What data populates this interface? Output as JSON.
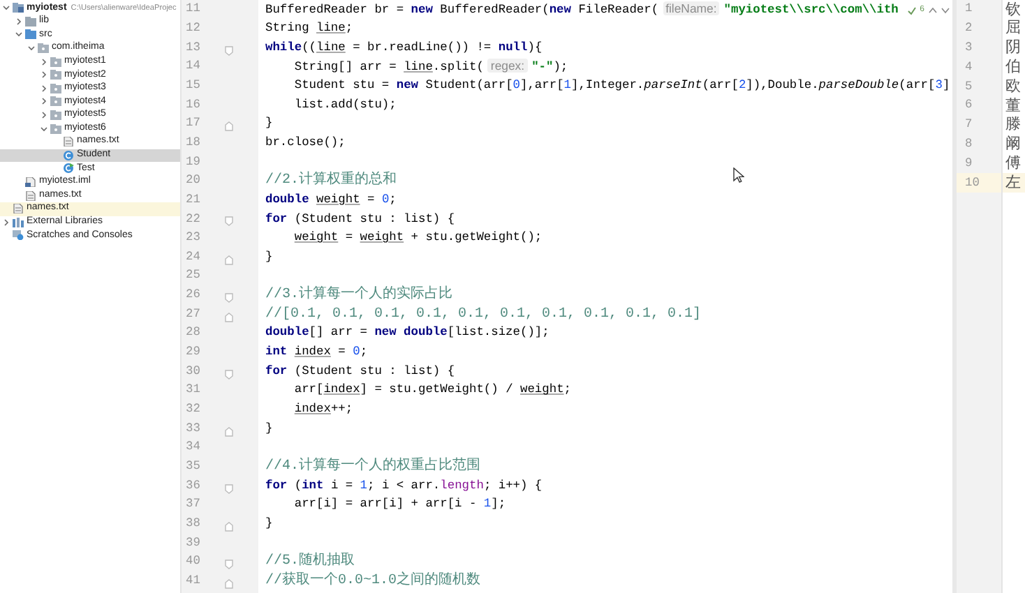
{
  "project_tree": {
    "items": [
      {
        "label": "myiotest",
        "kind": "module",
        "path": "C:\\Users\\alienware\\IdeaProjec",
        "expanded": true,
        "selected": false,
        "highlighted": false,
        "children": [
          {
            "label": "lib",
            "kind": "folder",
            "expanded": false,
            "selected": false,
            "highlighted": false
          },
          {
            "label": "src",
            "kind": "source-folder",
            "expanded": true,
            "selected": false,
            "highlighted": false,
            "children": [
              {
                "label": "com.itheima",
                "kind": "package",
                "expanded": true,
                "selected": false,
                "highlighted": false,
                "children": [
                  {
                    "label": "myiotest1",
                    "kind": "package",
                    "expanded": false,
                    "selected": false,
                    "highlighted": false
                  },
                  {
                    "label": "myiotest2",
                    "kind": "package",
                    "expanded": false,
                    "selected": false,
                    "highlighted": false
                  },
                  {
                    "label": "myiotest3",
                    "kind": "package",
                    "expanded": false,
                    "selected": false,
                    "highlighted": false
                  },
                  {
                    "label": "myiotest4",
                    "kind": "package",
                    "expanded": false,
                    "selected": false,
                    "highlighted": false
                  },
                  {
                    "label": "myiotest5",
                    "kind": "package",
                    "expanded": false,
                    "selected": false,
                    "highlighted": false
                  },
                  {
                    "label": "myiotest6",
                    "kind": "package",
                    "expanded": true,
                    "selected": false,
                    "highlighted": false,
                    "children": [
                      {
                        "label": "names.txt",
                        "kind": "text-file",
                        "selected": false,
                        "highlighted": false
                      },
                      {
                        "label": "Student",
                        "kind": "class",
                        "selected": true,
                        "highlighted": false
                      },
                      {
                        "label": "Test",
                        "kind": "runnable-class",
                        "selected": false,
                        "highlighted": false
                      }
                    ]
                  }
                ]
              }
            ]
          },
          {
            "label": "myiotest.iml",
            "kind": "module-file",
            "selected": false,
            "highlighted": false
          },
          {
            "label": "names.txt",
            "kind": "text-file",
            "selected": false,
            "highlighted": false
          }
        ]
      },
      {
        "label": "names.txt",
        "kind": "text-file",
        "selected": false,
        "highlighted": true
      },
      {
        "label": "External Libraries",
        "kind": "library",
        "expanded": false,
        "selected": false,
        "highlighted": false
      },
      {
        "label": "Scratches and Consoles",
        "kind": "scratches",
        "selected": false,
        "highlighted": false
      }
    ]
  },
  "editor": {
    "inspection": {
      "count": "6"
    },
    "lines": [
      {
        "number": "11",
        "segments": [
          {
            "kind": "plain",
            "text": "BufferedReader br = "
          },
          {
            "kind": "keyword",
            "text": "new"
          },
          {
            "kind": "plain",
            "text": " BufferedReader("
          },
          {
            "kind": "keyword",
            "text": "new"
          },
          {
            "kind": "plain",
            "text": " FileReader("
          },
          {
            "kind": "hint",
            "text": "fileName:"
          },
          {
            "kind": "string",
            "text": "\"myiotest\\\\src\\\\com\\\\ith"
          }
        ]
      },
      {
        "number": "12",
        "segments": [
          {
            "kind": "plain",
            "text": "String "
          },
          {
            "kind": "reassigned",
            "text": "line"
          },
          {
            "kind": "plain",
            "text": ";"
          }
        ]
      },
      {
        "number": "13",
        "kind": "fold-start",
        "segments": [
          {
            "kind": "keyword",
            "text": "while"
          },
          {
            "kind": "plain",
            "text": "(("
          },
          {
            "kind": "reassigned",
            "text": "line"
          },
          {
            "kind": "plain",
            "text": " = br.readLine()) != "
          },
          {
            "kind": "keyword",
            "text": "null"
          },
          {
            "kind": "plain",
            "text": "){"
          }
        ]
      },
      {
        "number": "14",
        "segments": [
          {
            "kind": "plain",
            "text": "    String[] arr = "
          },
          {
            "kind": "reassigned",
            "text": "line"
          },
          {
            "kind": "plain",
            "text": ".split("
          },
          {
            "kind": "hint",
            "text": "regex:"
          },
          {
            "kind": "string",
            "text": "\"-\""
          },
          {
            "kind": "plain",
            "text": ");"
          }
        ]
      },
      {
        "number": "15",
        "segments": [
          {
            "kind": "plain",
            "text": "    Student stu = "
          },
          {
            "kind": "keyword",
            "text": "new"
          },
          {
            "kind": "plain",
            "text": " Student(arr["
          },
          {
            "kind": "number",
            "text": "0"
          },
          {
            "kind": "plain",
            "text": "],arr["
          },
          {
            "kind": "number",
            "text": "1"
          },
          {
            "kind": "plain",
            "text": "],Integer."
          },
          {
            "kind": "static",
            "text": "parseInt"
          },
          {
            "kind": "plain",
            "text": "(arr["
          },
          {
            "kind": "number",
            "text": "2"
          },
          {
            "kind": "plain",
            "text": "]),Double."
          },
          {
            "kind": "static",
            "text": "parseDouble"
          },
          {
            "kind": "plain",
            "text": "(arr["
          },
          {
            "kind": "number",
            "text": "3"
          },
          {
            "kind": "plain",
            "text": "]"
          }
        ]
      },
      {
        "number": "16",
        "segments": [
          {
            "kind": "plain",
            "text": "    list.add(stu);"
          }
        ]
      },
      {
        "number": "17",
        "kind": "fold-end",
        "segments": [
          {
            "kind": "plain",
            "text": "}"
          }
        ]
      },
      {
        "number": "18",
        "segments": [
          {
            "kind": "plain",
            "text": "br.close();"
          }
        ]
      },
      {
        "number": "19"
      },
      {
        "number": "20",
        "segments": [
          {
            "kind": "comment",
            "text": "//2.计算权重的总和"
          }
        ]
      },
      {
        "number": "21",
        "segments": [
          {
            "kind": "keyword",
            "text": "double "
          },
          {
            "kind": "reassigned",
            "text": "weight"
          },
          {
            "kind": "plain",
            "text": " = "
          },
          {
            "kind": "number",
            "text": "0"
          },
          {
            "kind": "plain",
            "text": ";"
          }
        ]
      },
      {
        "number": "22",
        "kind": "fold-start",
        "segments": [
          {
            "kind": "keyword",
            "text": "for"
          },
          {
            "kind": "plain",
            "text": " (Student stu : list) {"
          }
        ]
      },
      {
        "number": "23",
        "segments": [
          {
            "kind": "reassigned",
            "text": "    weight"
          },
          {
            "kind": "plain",
            "text": " = "
          },
          {
            "kind": "reassigned",
            "text": "weight"
          },
          {
            "kind": "plain",
            "text": " + stu.getWeight();"
          }
        ]
      },
      {
        "number": "24",
        "kind": "fold-end",
        "segments": [
          {
            "kind": "plain",
            "text": "}"
          }
        ]
      },
      {
        "number": "25"
      },
      {
        "number": "26",
        "kind": "fold-start",
        "segments": [
          {
            "kind": "comment",
            "text": "//3.计算每一个人的实际占比"
          }
        ]
      },
      {
        "number": "27",
        "kind": "fold-end",
        "segments": [
          {
            "kind": "comment",
            "text": "//[0.1, 0.1, 0.1, 0.1, 0.1, 0.1, 0.1, 0.1, 0.1, 0.1]"
          }
        ]
      },
      {
        "number": "28",
        "segments": [
          {
            "kind": "keyword",
            "text": "double"
          },
          {
            "kind": "plain",
            "text": "[] arr = "
          },
          {
            "kind": "keyword",
            "text": "new double"
          },
          {
            "kind": "plain",
            "text": "[list.size()];"
          }
        ]
      },
      {
        "number": "29",
        "segments": [
          {
            "kind": "keyword",
            "text": "int "
          },
          {
            "kind": "reassigned",
            "text": "index"
          },
          {
            "kind": "plain",
            "text": " = "
          },
          {
            "kind": "number",
            "text": "0"
          },
          {
            "kind": "plain",
            "text": ";"
          }
        ]
      },
      {
        "number": "30",
        "kind": "fold-start",
        "segments": [
          {
            "kind": "keyword",
            "text": "for"
          },
          {
            "kind": "plain",
            "text": " (Student stu : list) {"
          }
        ]
      },
      {
        "number": "31",
        "segments": [
          {
            "kind": "plain",
            "text": "    arr["
          },
          {
            "kind": "reassigned",
            "text": "index"
          },
          {
            "kind": "plain",
            "text": "] = stu.getWeight() / "
          },
          {
            "kind": "reassigned",
            "text": "weight"
          },
          {
            "kind": "plain",
            "text": ";"
          }
        ]
      },
      {
        "number": "32",
        "segments": [
          {
            "kind": "reassigned",
            "text": "    index"
          },
          {
            "kind": "plain",
            "text": "++;"
          }
        ]
      },
      {
        "number": "33",
        "kind": "fold-end",
        "segments": [
          {
            "kind": "plain",
            "text": "}"
          }
        ]
      },
      {
        "number": "34"
      },
      {
        "number": "35",
        "segments": [
          {
            "kind": "comment",
            "text": "//4.计算每一个人的权重占比范围"
          }
        ]
      },
      {
        "number": "36",
        "kind": "fold-start",
        "segments": [
          {
            "kind": "keyword",
            "text": "for"
          },
          {
            "kind": "plain",
            "text": " ("
          },
          {
            "kind": "keyword",
            "text": "int"
          },
          {
            "kind": "plain",
            "text": " i = "
          },
          {
            "kind": "number",
            "text": "1"
          },
          {
            "kind": "plain",
            "text": "; i < arr."
          },
          {
            "kind": "field",
            "text": "length"
          },
          {
            "kind": "plain",
            "text": "; i++) {"
          }
        ]
      },
      {
        "number": "37",
        "segments": [
          {
            "kind": "plain",
            "text": "    arr[i] = arr[i] + arr[i - "
          },
          {
            "kind": "number",
            "text": "1"
          },
          {
            "kind": "plain",
            "text": "];"
          }
        ]
      },
      {
        "number": "38",
        "kind": "fold-end",
        "segments": [
          {
            "kind": "plain",
            "text": "}"
          }
        ]
      },
      {
        "number": "39"
      },
      {
        "number": "40",
        "kind": "fold-start",
        "segments": [
          {
            "kind": "comment",
            "text": "//5.随机抽取"
          }
        ]
      },
      {
        "number": "41",
        "kind": "fold-end",
        "segments": [
          {
            "kind": "comment",
            "text": "//获取一个0.0~1.0之间的随机数"
          }
        ]
      }
    ]
  },
  "preview": {
    "lines": [
      {
        "number": "1",
        "text": "钦",
        "current": false
      },
      {
        "number": "2",
        "text": "屈",
        "current": false
      },
      {
        "number": "3",
        "text": "阴",
        "current": false
      },
      {
        "number": "4",
        "text": "伯",
        "current": false
      },
      {
        "number": "5",
        "text": "欧",
        "current": false
      },
      {
        "number": "6",
        "text": "董",
        "current": false
      },
      {
        "number": "7",
        "text": "滕",
        "current": false
      },
      {
        "number": "8",
        "text": "阚",
        "current": false
      },
      {
        "number": "9",
        "text": "傅",
        "current": false
      },
      {
        "number": "10",
        "text": "左",
        "current": true
      }
    ]
  }
}
